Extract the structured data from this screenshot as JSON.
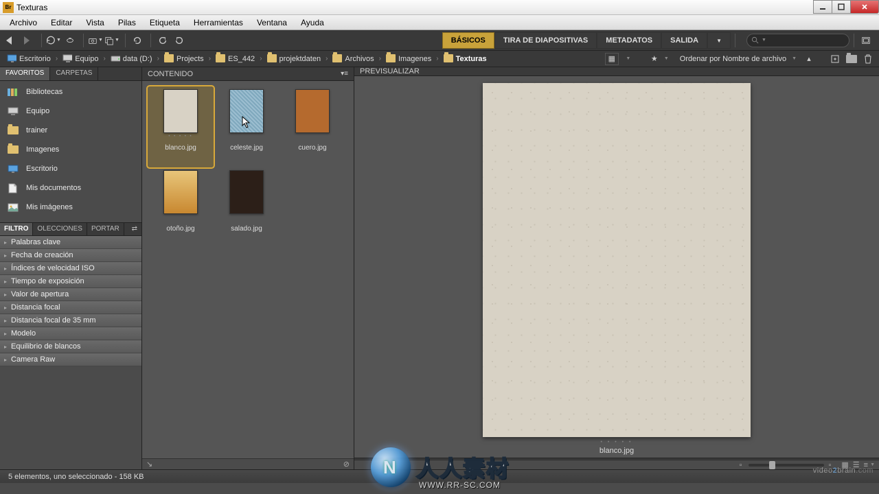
{
  "window": {
    "title": "Texturas"
  },
  "menu": [
    "Archivo",
    "Editar",
    "Vista",
    "Pilas",
    "Etiqueta",
    "Herramientas",
    "Ventana",
    "Ayuda"
  ],
  "modes": [
    {
      "label": "BÁSICOS",
      "active": true
    },
    {
      "label": "TIRA DE DIAPOSITIVAS",
      "active": false
    },
    {
      "label": "METADATOS",
      "active": false
    },
    {
      "label": "SALIDA",
      "active": false
    }
  ],
  "path": [
    {
      "label": "Escritorio",
      "icon": "desktop"
    },
    {
      "label": "Equipo",
      "icon": "computer"
    },
    {
      "label": "data (D:)",
      "icon": "drive"
    },
    {
      "label": "Projects",
      "icon": "folder"
    },
    {
      "label": "ES_442",
      "icon": "folder"
    },
    {
      "label": "projektdaten",
      "icon": "folder"
    },
    {
      "label": "Archivos",
      "icon": "folder"
    },
    {
      "label": "Imagenes",
      "icon": "folder"
    },
    {
      "label": "Texturas",
      "icon": "folder",
      "bold": true
    }
  ],
  "sort": {
    "label": "Ordenar por Nombre de archivo"
  },
  "left": {
    "tabs": [
      {
        "label": "FAVORITOS",
        "active": true
      },
      {
        "label": "CARPETAS",
        "active": false
      }
    ],
    "items": [
      {
        "label": "Bibliotecas",
        "icon": "libraries"
      },
      {
        "label": "Equipo",
        "icon": "computer"
      },
      {
        "label": "trainer",
        "icon": "folder"
      },
      {
        "label": "Imagenes",
        "icon": "folder"
      },
      {
        "label": "Escritorio",
        "icon": "desktop"
      },
      {
        "label": "Mis documentos",
        "icon": "documents"
      },
      {
        "label": "Mis imágenes",
        "icon": "pictures"
      }
    ],
    "filter_tabs": [
      {
        "label": "FILTRO",
        "active": true
      },
      {
        "label": "OLECCIONES",
        "active": false
      },
      {
        "label": "PORTAR",
        "active": false
      }
    ],
    "filters": [
      "Palabras clave",
      "Fecha de creación",
      "Índices de velocidad ISO",
      "Tiempo de exposición",
      "Valor de apertura",
      "Distancia focal",
      "Distancia focal de 35 mm",
      "Modelo",
      "Equilibrio de blancos",
      "Camera Raw"
    ]
  },
  "content": {
    "header": "CONTENIDO",
    "thumbs": [
      {
        "name": "blanco.jpg",
        "color": "#d8d2c5",
        "sel": true
      },
      {
        "name": "celeste.jpg",
        "color": "#8fb4c8",
        "sel": false
      },
      {
        "name": "cuero.jpg",
        "color": "#b56a2e",
        "sel": false
      },
      {
        "name": "otoño.jpg",
        "color": "#d6a659",
        "sel": false
      },
      {
        "name": "salado.jpg",
        "color": "#2c1f18",
        "sel": false
      }
    ]
  },
  "preview": {
    "header": "PREVISUALIZAR",
    "caption": "blanco.jpg"
  },
  "status": "5 elementos, uno seleccionado - 158 KB",
  "watermark": {
    "main": "人人素材",
    "sub": "WWW.RR-SC.COM"
  },
  "brand": {
    "a": "video",
    "b": "2",
    "c": "brain",
    "d": ".com"
  }
}
